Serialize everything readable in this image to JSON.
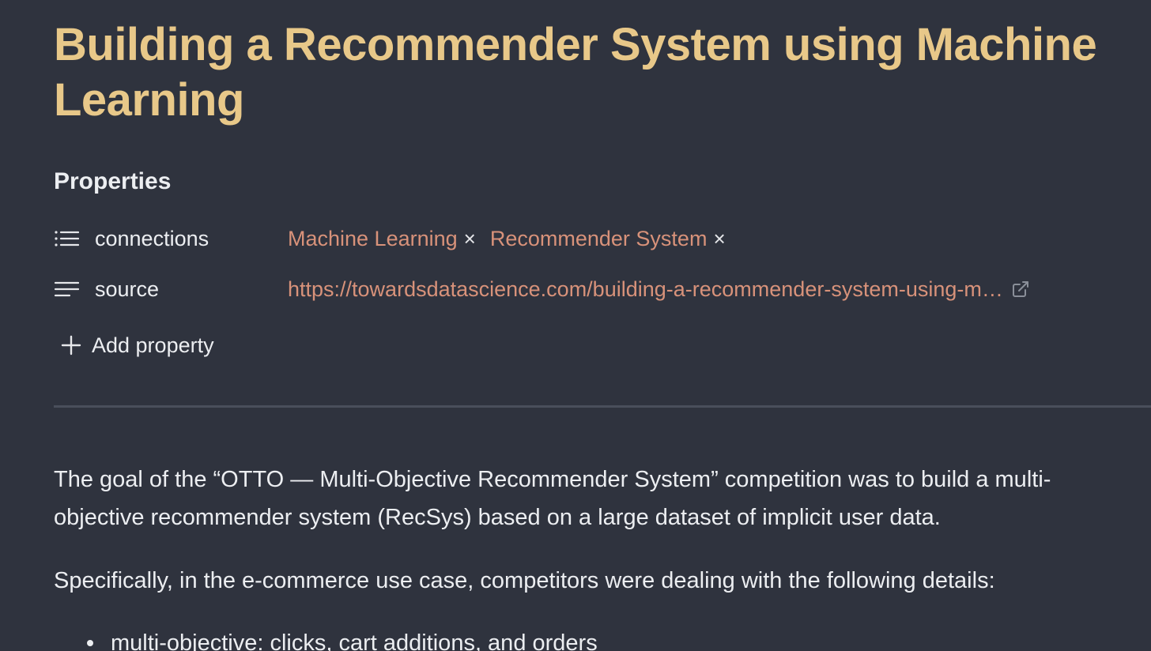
{
  "note": {
    "title": "Building a Recommender System using Machine Learning"
  },
  "properties": {
    "heading": "Properties",
    "connections": {
      "key": "connections",
      "icon": "list-icon",
      "tags": [
        "Machine Learning",
        "Recommender System"
      ],
      "remove_glyph": "×"
    },
    "source": {
      "key": "source",
      "icon": "text-lines-icon",
      "value": "https://towardsdatascience.com/building-a-recommender-system-using-m…",
      "link_icon": "external-link-icon"
    },
    "add_label": "Add property"
  },
  "content": {
    "paragraphs": [
      "The goal of the “OTTO — Multi-Objective Recommender System” competition was to build a multi-objective recommender system (RecSys) based on a large dataset of implicit user data.",
      "Specifically, in the e-commerce use case, competitors were dealing with the following details:"
    ],
    "bullets": [
      "multi-objective: clicks, cart additions, and orders"
    ]
  },
  "colors": {
    "background": "#2f333e",
    "title": "#e8c889",
    "accent": "#d8927a",
    "text": "#eceef1",
    "divider": "#4a4f5b"
  }
}
